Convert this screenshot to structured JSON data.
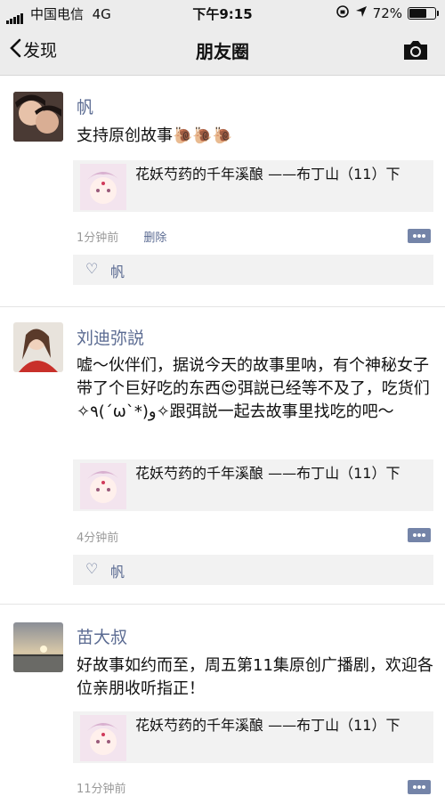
{
  "status_bar": {
    "carrier": "中国电信",
    "network": "4G",
    "time": "下午9:15",
    "battery": "72%",
    "battery_level": 0.72
  },
  "nav": {
    "back_label": "发现",
    "title": "朋友圈"
  },
  "posts": [
    {
      "name": "帆",
      "text": "支持原创故事🐌🐌🐌",
      "share_title": "花妖芍药的千年溪酿 ——布丁山（11）下",
      "time": "1分钟前",
      "delete_label": "删除",
      "likes": "帆"
    },
    {
      "name": "刘迪弥説",
      "text": "嘘～伙伴们，据说今天的故事里呐，有个神秘女子带了个巨好吃的东西😍弭説已经等不及了，吃货们✧٩(ˊωˋ*)و✧跟弭説一起去故事里找吃的吧～",
      "share_title": "花妖芍药的千年溪酿 ——布丁山（11）下",
      "time": "4分钟前",
      "likes": "帆"
    },
    {
      "name": "苗大叔",
      "text": "好故事如约而至，周五第11集原创广播剧，欢迎各位亲朋收听指正！",
      "share_title": "花妖芍药的千年溪酿 ——布丁山（11）下",
      "time": "11分钟前"
    }
  ]
}
